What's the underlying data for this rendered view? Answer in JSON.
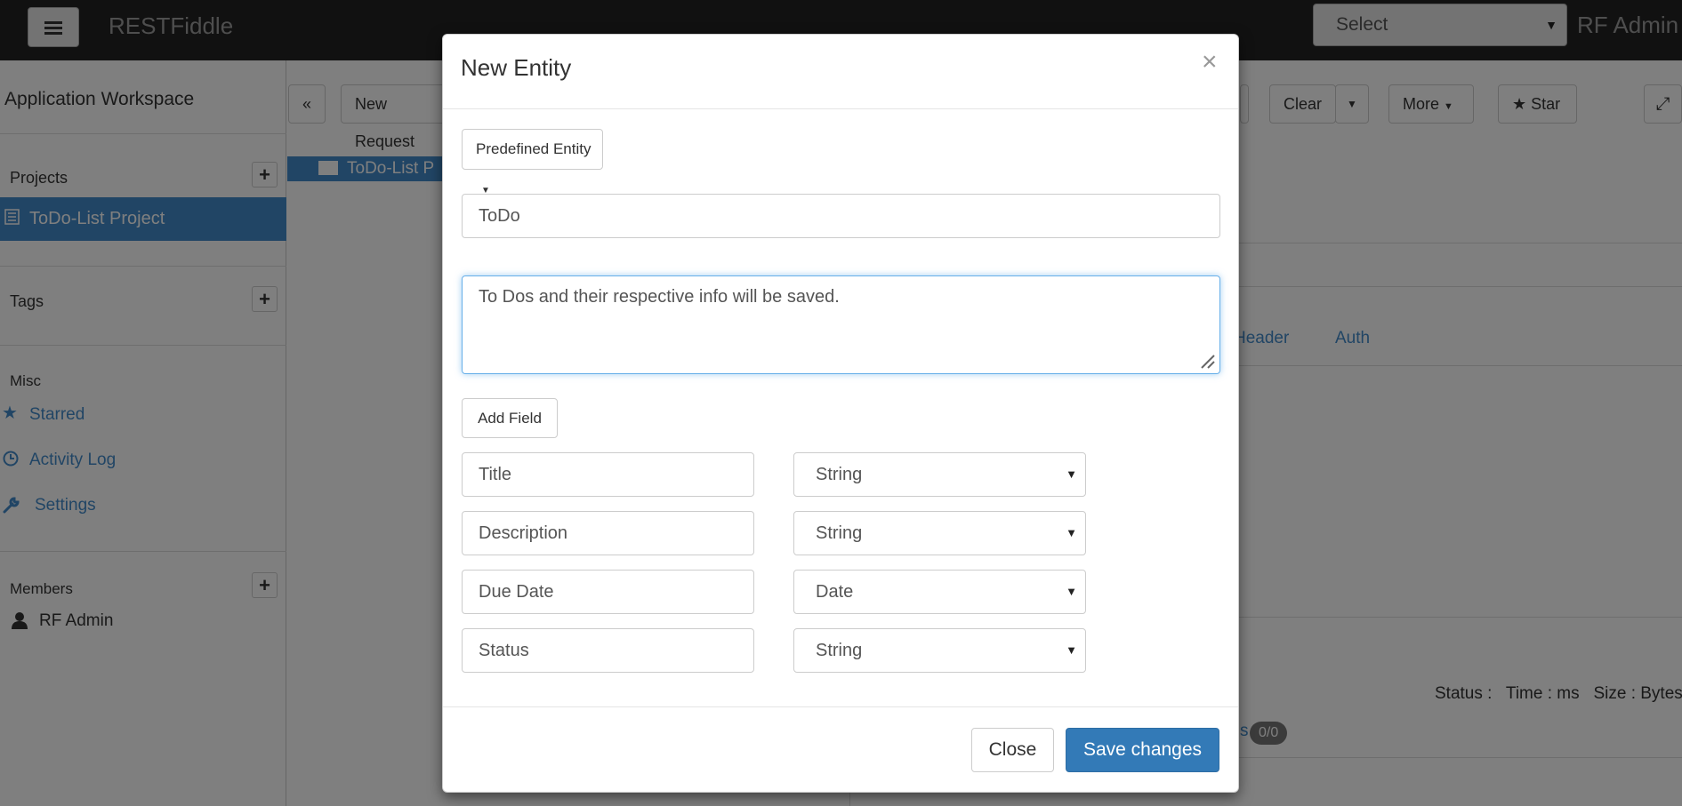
{
  "navbar": {
    "brand": "RESTFiddle",
    "select_value": "Select",
    "user": "RF Admin"
  },
  "sidebar": {
    "title": "Application Workspace",
    "projects_label": "Projects",
    "active_project": "ToDo-List Project",
    "tags_label": "Tags",
    "misc_label": "Misc",
    "starred": "Starred",
    "activity_log": "Activity Log",
    "settings": "Settings",
    "members_label": "Members",
    "member_name": "RF Admin"
  },
  "toolbar": {
    "collapse": "«",
    "new_request": "New Request",
    "clear": "Clear",
    "more": "More",
    "star": "Star"
  },
  "tree": {
    "item": "ToDo-List P"
  },
  "main": {
    "tab_header": "Header",
    "tab_auth": "Auth",
    "status_label": "Status :",
    "time_label": "Time : ms",
    "size_label": "Size : Bytes",
    "badge": "0/0",
    "badge_prefix": "s"
  },
  "modal": {
    "title": "New Entity",
    "close_x": "×",
    "entity_dropdown": "Predefined Entity",
    "name_value": "ToDo",
    "description_value": "To Dos and their respective info will be saved.",
    "add_field": "Add Field",
    "fields": [
      {
        "name": "Title",
        "type": "String"
      },
      {
        "name": "Description",
        "type": "String"
      },
      {
        "name": "Due Date",
        "type": "Date"
      },
      {
        "name": "Status",
        "type": "String"
      }
    ],
    "close_button": "Close",
    "save_button": "Save changes"
  }
}
